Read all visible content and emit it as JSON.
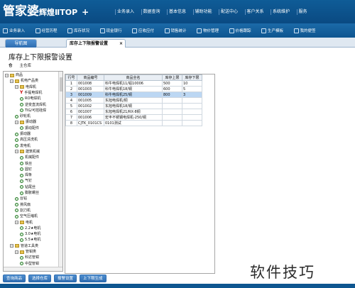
{
  "app": {
    "brand_main": "管家婆",
    "brand_sub": "辉煌",
    "brand_ver": "ⅡTOP",
    "brand_plus": "+"
  },
  "topnav": [
    "业务录入",
    "数据查询",
    "基本信息",
    "辅助功能",
    "配送中心",
    "客户关系",
    "系统维护",
    "服务"
  ],
  "toolbar": [
    {
      "label": "业务录入",
      "icon": "edit-icon"
    },
    {
      "label": "经营历程",
      "icon": "chart-icon"
    },
    {
      "label": "库存状况",
      "icon": "box-icon"
    },
    {
      "label": "现金银行",
      "icon": "bank-icon"
    },
    {
      "label": "应收应付",
      "icon": "money-icon"
    },
    {
      "label": "销售统计",
      "icon": "stats-icon"
    },
    {
      "label": "物价管理",
      "icon": "price-icon"
    },
    {
      "label": "价格跟踪",
      "icon": "track-icon"
    },
    {
      "label": "生产模板",
      "icon": "gear-icon"
    },
    {
      "label": "我的便签",
      "icon": "note-icon"
    }
  ],
  "tabs": {
    "nav": "导航图",
    "active": "库存上下限报警设置",
    "close": "×"
  },
  "page": {
    "title": "库存上下限报警设置",
    "loc_label": "仓",
    "loc_value": "主仓库"
  },
  "tree": [
    {
      "label": "商品",
      "indent": 0,
      "kind": "root"
    },
    {
      "label": "机电产品类",
      "indent": 1,
      "kind": "folder"
    },
    {
      "label": "电焊机",
      "indent": 2,
      "kind": "folder"
    },
    {
      "label": "手提电焊机",
      "indent": 3,
      "kind": "red"
    },
    {
      "label": "RO电焊机",
      "indent": 3,
      "kind": "circle"
    },
    {
      "label": "逆变直流焊机",
      "indent": 3,
      "kind": "circle"
    },
    {
      "label": "TIG/可控硅焊",
      "indent": 3,
      "kind": "circle"
    },
    {
      "label": "砂轮机",
      "indent": 2,
      "kind": "circle"
    },
    {
      "label": "振动器",
      "indent": 2,
      "kind": "folder"
    },
    {
      "label": "振动配件",
      "indent": 3,
      "kind": "circle"
    },
    {
      "label": "振动器",
      "indent": 2,
      "kind": "circle"
    },
    {
      "label": "高压清洗机",
      "indent": 2,
      "kind": "circle"
    },
    {
      "label": "发电机",
      "indent": 2,
      "kind": "circle"
    },
    {
      "label": "建筑机械",
      "indent": 2,
      "kind": "folder"
    },
    {
      "label": "机械配件",
      "indent": 3,
      "kind": "circle"
    },
    {
      "label": "铁丝",
      "indent": 3,
      "kind": "circle"
    },
    {
      "label": "圆钉",
      "indent": 3,
      "kind": "circle"
    },
    {
      "label": "焊条",
      "indent": 3,
      "kind": "circle"
    },
    {
      "label": "气钉",
      "indent": 3,
      "kind": "circle"
    },
    {
      "label": "钻尾丝",
      "indent": 3,
      "kind": "circle"
    },
    {
      "label": "膨胀螺丝",
      "indent": 3,
      "kind": "circle"
    },
    {
      "label": "台钻",
      "indent": 2,
      "kind": "circle"
    },
    {
      "label": "排风扇",
      "indent": 2,
      "kind": "circle"
    },
    {
      "label": "割刀机",
      "indent": 2,
      "kind": "circle"
    },
    {
      "label": "空气压缩机",
      "indent": 2,
      "kind": "circle"
    },
    {
      "label": "电机",
      "indent": 2,
      "kind": "folder"
    },
    {
      "label": "2.2★电机",
      "indent": 3,
      "kind": "circle"
    },
    {
      "label": "3.0★电机",
      "indent": 3,
      "kind": "circle"
    },
    {
      "label": "5.5★电机",
      "indent": 3,
      "kind": "circle"
    },
    {
      "label": "管道工具类",
      "indent": 1,
      "kind": "folder"
    },
    {
      "label": "管钳类",
      "indent": 2,
      "kind": "folder"
    },
    {
      "label": "科达管钳",
      "indent": 3,
      "kind": "circle"
    },
    {
      "label": "中型管钳",
      "indent": 3,
      "kind": "circle"
    }
  ],
  "grid": {
    "headers": [
      "行号",
      "商品编号",
      "商品全名",
      "库存上限",
      "库存下限"
    ],
    "rows": [
      [
        "1",
        "001008",
        "科牛电焊机11/铝10006",
        "500",
        "10"
      ],
      [
        "2",
        "001003",
        "科牛电焊机18/铜",
        "600",
        "5"
      ],
      [
        "3",
        "001009",
        "科牛电焊机25/铜",
        "800",
        "3"
      ],
      [
        "4",
        "001005",
        "东旭电焊机/铜",
        "",
        ""
      ],
      [
        "5",
        "001002",
        "东旭电焊机18/铜",
        "",
        ""
      ],
      [
        "6",
        "001007",
        "东旭电焊机21/RX-8铜",
        "",
        ""
      ],
      [
        "7",
        "001006",
        "宏丰不锈钢电焊机-250/铜",
        "",
        ""
      ],
      [
        "8",
        "CJTK_0101CS",
        "0101测试",
        "",
        ""
      ]
    ],
    "selected_row": 3
  },
  "buttons": [
    "查询商品",
    "选择仓库",
    "报警设置",
    "上下限生成"
  ],
  "watermark": "软件技巧"
}
